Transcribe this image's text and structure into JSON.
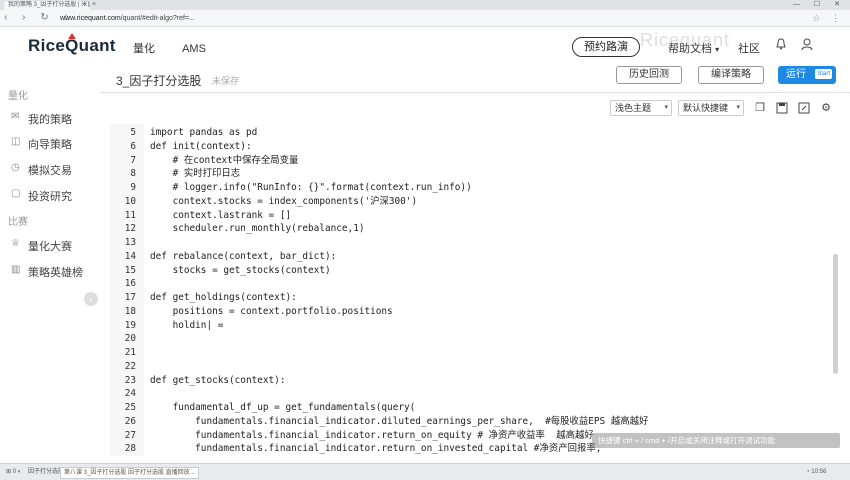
{
  "browser": {
    "tab_title": "我的策略 3_因子打分选股 | 米筐",
    "url_host": "www.ricequant.com",
    "url_path": "/quant/#edit-algo?ref=...",
    "window_controls": "— ☐ ✕",
    "nav_buttons": "‹ › ↻ ⌂",
    "ext_icons": "☆ ⋮"
  },
  "header": {
    "logo_left": "Rice",
    "logo_q": "Q",
    "logo_right": "uant",
    "nav": [
      "量化",
      "AMS"
    ],
    "contest_btn": "预约路演",
    "help": "帮助文档",
    "community": "社区"
  },
  "sidebar": {
    "section1": "量化",
    "items1": [
      {
        "icon": "✉",
        "label": "我的策略"
      },
      {
        "icon": "◫",
        "label": "向导策略"
      },
      {
        "icon": "◷",
        "label": "模拟交易"
      },
      {
        "icon": "▢",
        "label": "投资研究"
      }
    ],
    "section2": "比赛",
    "items2": [
      {
        "icon": "♕",
        "label": "量化大赛"
      },
      {
        "icon": "▥",
        "label": "策略英雄榜"
      }
    ],
    "collapse": "‹"
  },
  "strategy": {
    "title": "3_因子打分选股",
    "saved": "未保存",
    "history_btn": "历史回测",
    "compile_btn": "编译策略",
    "run_btn": "运行",
    "run_hint": "Start"
  },
  "toolbar": {
    "theme": "浅色主题",
    "keymap": "默认快捷键"
  },
  "editor": {
    "lines": [
      {
        "n": "5",
        "t": "import pandas as pd"
      },
      {
        "n": "6",
        "t": "def init(context):"
      },
      {
        "n": "7",
        "t": "    # 在context中保存全局变量"
      },
      {
        "n": "8",
        "t": "    # 实时打印日志"
      },
      {
        "n": "9",
        "t": "    # logger.info(\"RunInfo: {}\".format(context.run_info))"
      },
      {
        "n": "10",
        "t": "    context.stocks = index_components('沪深300')"
      },
      {
        "n": "11",
        "t": "    context.lastrank = []"
      },
      {
        "n": "12",
        "t": "    scheduler.run_monthly(rebalance,1)"
      },
      {
        "n": "13",
        "t": ""
      },
      {
        "n": "14",
        "t": "def rebalance(context, bar_dict):"
      },
      {
        "n": "15",
        "t": "    stocks = get_stocks(context)"
      },
      {
        "n": "16",
        "t": ""
      },
      {
        "n": "17",
        "t": "def get_holdings(context):"
      },
      {
        "n": "18",
        "t": "    positions = context.portfolio.positions"
      },
      {
        "n": "19",
        "t": "    holdin| ="
      },
      {
        "n": "20",
        "t": ""
      },
      {
        "n": "21",
        "t": ""
      },
      {
        "n": "22",
        "t": ""
      },
      {
        "n": "23",
        "t": "def get_stocks(context):"
      },
      {
        "n": "24",
        "t": ""
      },
      {
        "n": "25",
        "t": "    fundamental_df_up = get_fundamentals(query("
      },
      {
        "n": "26",
        "t": "        fundamentals.financial_indicator.diluted_earnings_per_share,  #每股收益EPS 越高越好"
      },
      {
        "n": "27",
        "t": "        fundamentals.financial_indicator.return_on_equity # 净资产收益率  越高越好"
      },
      {
        "n": "28",
        "t": "        fundamentals.financial_indicator.return_on_invested_capital #净资产回报率,"
      }
    ]
  },
  "toast": "快捷键 ctrl + / cmd + /开启或关闭注释或打开调试功能",
  "taskbar": {
    "items": [
      "⊞ 0 ◐",
      "因子打分选股",
      "第八课 3_因子打分选股 因子打分选股 直播回放...",
      "◔ 10:56"
    ]
  },
  "watermark": "Ricequant"
}
